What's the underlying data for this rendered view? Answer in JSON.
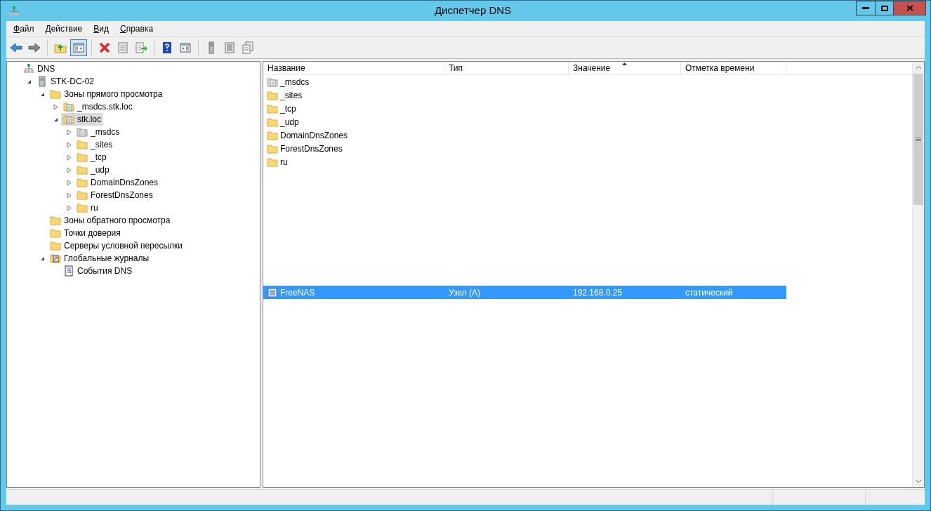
{
  "window": {
    "title": "Диспетчер DNS"
  },
  "menu": [
    "Файл",
    "Действие",
    "Вид",
    "Справка"
  ],
  "toolbar": [
    {
      "buttons": [
        {
          "kind": "back",
          "selected": false
        },
        {
          "kind": "forward",
          "selected": false
        }
      ]
    },
    {
      "buttons": [
        {
          "kind": "up",
          "selected": false
        },
        {
          "kind": "pane",
          "selected": true
        }
      ]
    },
    {
      "buttons": [
        {
          "kind": "delete",
          "selected": false
        },
        {
          "kind": "props",
          "selected": false
        },
        {
          "kind": "export",
          "selected": false
        }
      ]
    },
    {
      "buttons": [
        {
          "kind": "help",
          "selected": false
        },
        {
          "kind": "pane2",
          "selected": false
        }
      ]
    },
    {
      "buttons": [
        {
          "kind": "server",
          "selected": false
        },
        {
          "kind": "list",
          "selected": false
        },
        {
          "kind": "copy",
          "selected": false
        }
      ]
    }
  ],
  "tree": [
    {
      "label": "DNS",
      "kind": "dns",
      "selected": false,
      "children": [
        {
          "label": "STK-DC-02",
          "kind": "server",
          "expanded": true,
          "selected": false,
          "children": [
            {
              "label": "Зоны прямого просмотра",
              "kind": "folder",
              "expanded": true,
              "selected": false,
              "children": [
                {
                  "label": "_msdcs.stk.loc",
                  "kind": "zone",
                  "expanded": false,
                  "selected": false
                },
                {
                  "label": "stk.loc",
                  "kind": "zone",
                  "expanded": true,
                  "selected": true,
                  "children": [
                    {
                      "label": "_msdcs",
                      "kind": "delegation",
                      "expanded": false,
                      "selected": false
                    },
                    {
                      "label": "_sites",
                      "kind": "folder",
                      "expanded": false,
                      "selected": false
                    },
                    {
                      "label": "_tcp",
                      "kind": "folder",
                      "expanded": false,
                      "selected": false
                    },
                    {
                      "label": "_udp",
                      "kind": "folder",
                      "expanded": false,
                      "selected": false
                    },
                    {
                      "label": "DomainDnsZones",
                      "kind": "folder",
                      "expanded": false,
                      "selected": false
                    },
                    {
                      "label": "ForestDnsZones",
                      "kind": "folder",
                      "expanded": false,
                      "selected": false
                    },
                    {
                      "label": "ru",
                      "kind": "folder",
                      "expanded": false,
                      "selected": false
                    }
                  ]
                }
              ]
            },
            {
              "label": "Зоны обратного просмотра",
              "kind": "folder",
              "selected": false
            },
            {
              "label": "Точки доверия",
              "kind": "folder",
              "selected": false
            },
            {
              "label": "Серверы условной пересылки",
              "kind": "folder",
              "selected": false
            },
            {
              "label": "Глобальные журналы",
              "kind": "log",
              "expanded": true,
              "selected": false,
              "children": [
                {
                  "label": "События DNS",
                  "kind": "event",
                  "selected": false
                }
              ]
            }
          ]
        }
      ]
    }
  ],
  "list": {
    "columns": [
      {
        "label": "Название",
        "sorted": false
      },
      {
        "label": "Тип",
        "sorted": false
      },
      {
        "label": "Значение",
        "sorted": true
      },
      {
        "label": "Отметка времени",
        "sorted": false
      }
    ],
    "folders": [
      {
        "name": "_msdcs",
        "kind": "delegation"
      },
      {
        "name": "_sites",
        "kind": "folder"
      },
      {
        "name": "_tcp",
        "kind": "folder"
      },
      {
        "name": "_udp",
        "kind": "folder"
      },
      {
        "name": "DomainDnsZones",
        "kind": "folder"
      },
      {
        "name": "ForestDnsZones",
        "kind": "folder"
      },
      {
        "name": "ru",
        "kind": "folder"
      }
    ],
    "records": [
      {
        "name": "FreeNAS",
        "type": "Узел (A)",
        "value": "192.168.0.25",
        "timestamp": "статический",
        "kind": "record",
        "selected": true
      }
    ]
  }
}
